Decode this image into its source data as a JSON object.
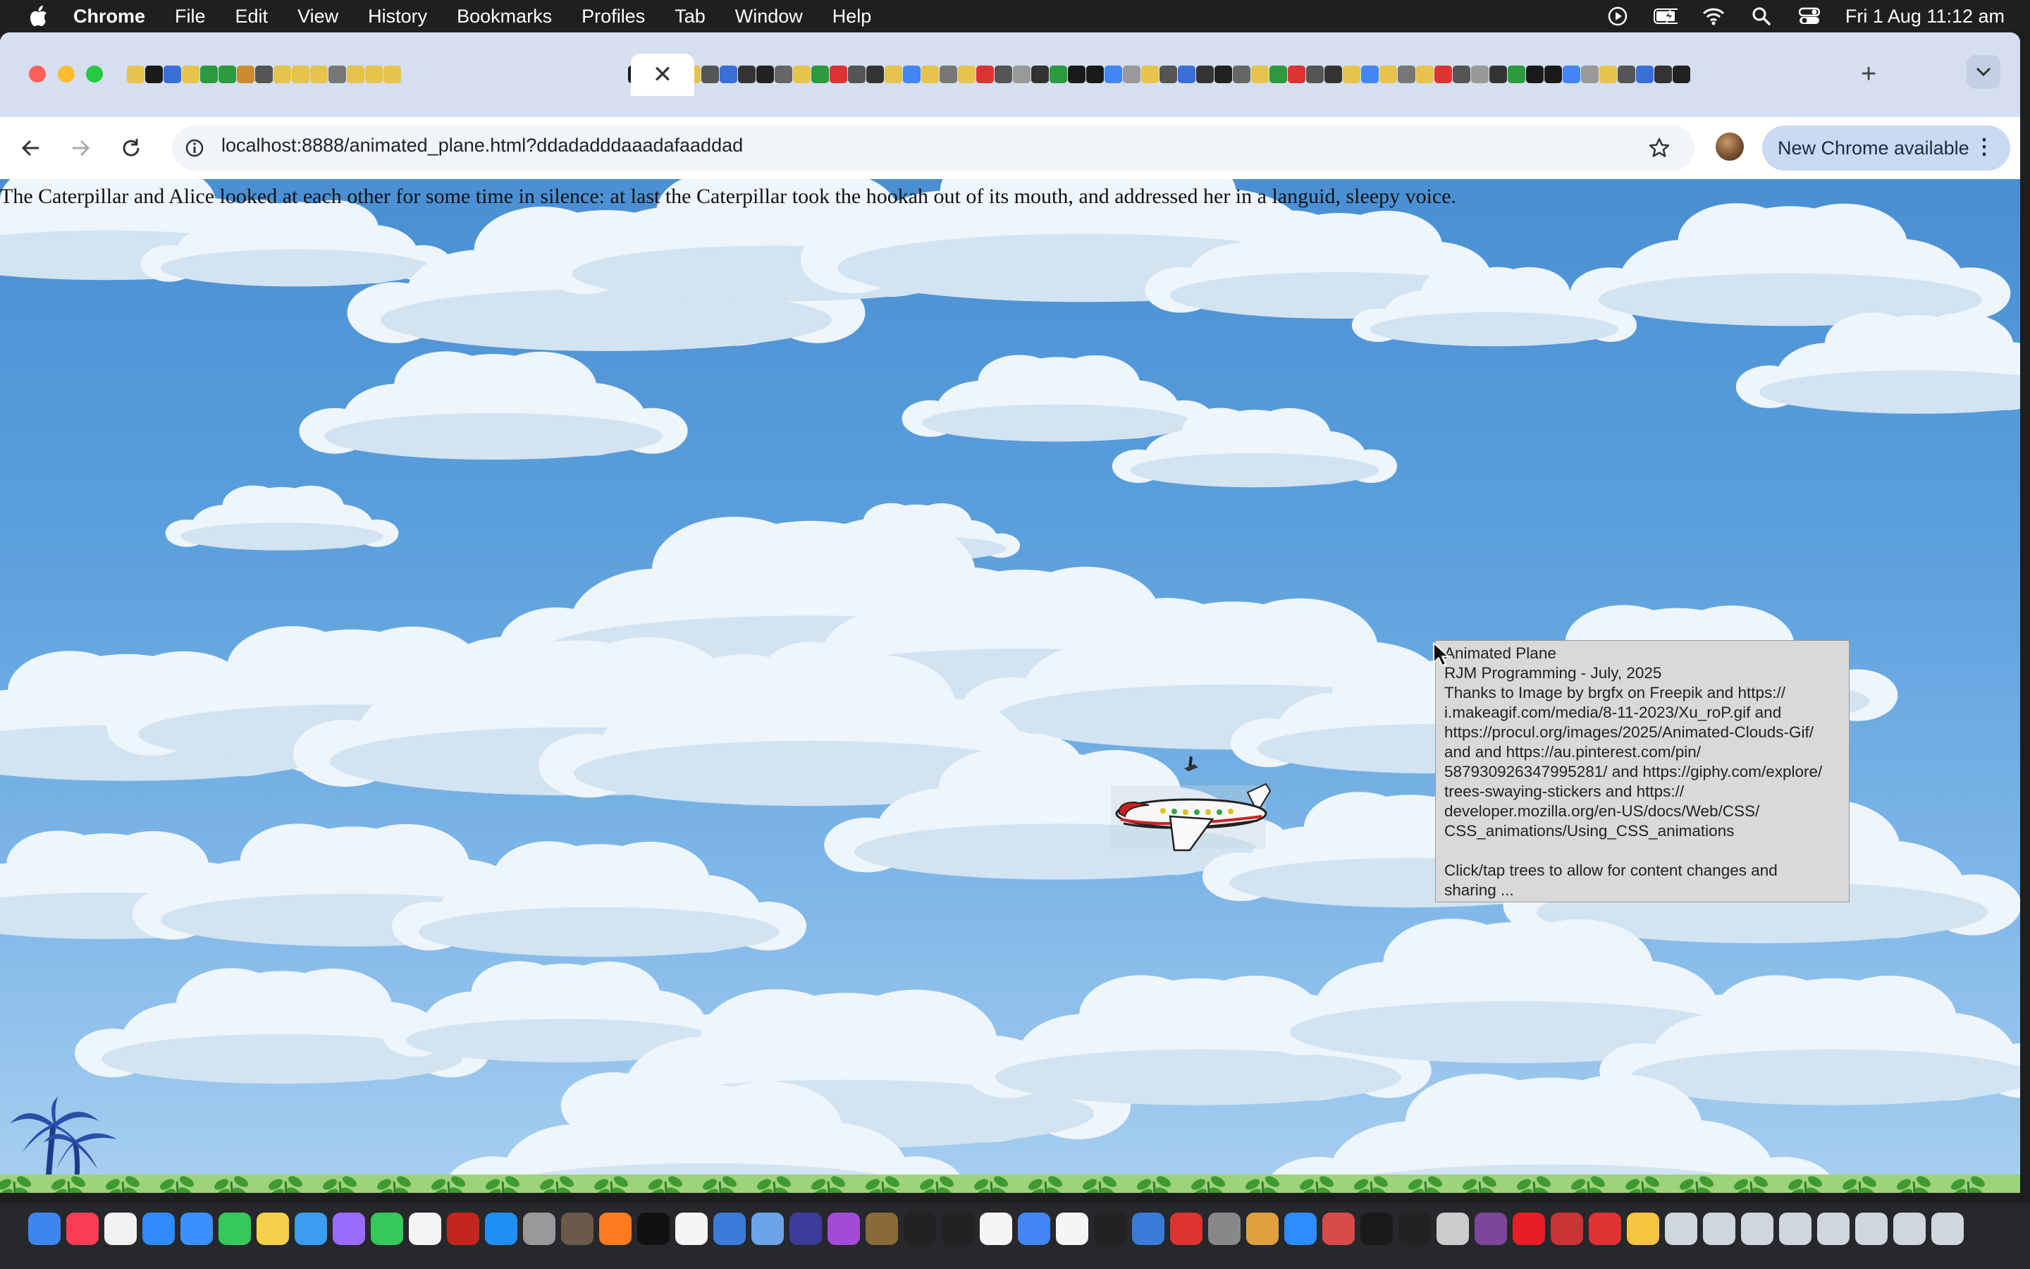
{
  "menubar": {
    "app_name": "Chrome",
    "items": [
      "File",
      "Edit",
      "View",
      "History",
      "Bookmarks",
      "Profiles",
      "Tab",
      "Window",
      "Help"
    ],
    "clock": "Fri 1 Aug  11:12 am",
    "status_icons": [
      "play-circle-icon",
      "battery-charging-icon",
      "wifi-icon",
      "spotlight-search-icon",
      "control-center-icon"
    ]
  },
  "browser": {
    "active_tab_close": "✕",
    "new_tab": "+",
    "url": "localhost:8888/animated_plane.html?ddadadddaaadafaaddad",
    "update_button": "New Chrome available",
    "update_menu": "⋮"
  },
  "page": {
    "paragraph": "The Caterpillar and Alice looked at each other for some time in silence: at last the Caterpillar took the hookah out of its mouth, and addressed her in a languid, sleepy voice.",
    "tooltip_lines": [
      "Animated Plane",
      "RJM Programming - July, 2025",
      "Thanks to Image by brgfx on Freepik and https://",
      "i.makeagif.com/media/8-11-2023/Xu_roP.gif and",
      "https://procul.org/images/2025/Animated-Clouds-Gif/",
      "and  and https://au.pinterest.com/pin/",
      "587930926347995281/ and https://giphy.com/explore/",
      "trees-swaying-stickers and https://",
      "developer.mozilla.org/en-US/docs/Web/CSS/",
      "CSS_animations/Using_CSS_animations",
      "",
      "Click/tap trees to allow for content changes and",
      "sharing ..."
    ]
  },
  "colors": {
    "menubar": "#1f1f1f",
    "tabstrip": "#d5dff0",
    "sky_top": "#4a8fd3",
    "sky_bottom": "#a8cff0",
    "tooltip_bg": "#d9d9d9",
    "update_button": "#c9daf5",
    "dock": "#26282c"
  },
  "dock_apps": [
    "finder-icon",
    "music-icon",
    "reminders-icon",
    "safari-icon",
    "mail-icon",
    "messages-icon",
    "notes-icon",
    "freeform-icon",
    "launchpad-icon",
    "facetime-icon",
    "textedit-icon",
    "filezilla-icon",
    "app-store-icon",
    "calculator-icon",
    "gimp-icon",
    "firefox-icon",
    "apple-tv-icon",
    "news-icon",
    "xcode-icon",
    "preview-icon",
    "bbedit-icon",
    "podcasts-icon",
    "keychain-icon",
    "terminal-icon",
    "terminal-icon",
    "calendar-icon",
    "chrome-icon",
    "file-icon",
    "terminal-icon",
    "finder-search-icon",
    "intellij-icon",
    "system-settings-icon",
    "photo-icon",
    "zoom-icon",
    "affinity-icon",
    "inkscape-icon",
    "mamp-icon",
    "script-editor-icon",
    "tor-icon",
    "opera-icon",
    "compass-icon",
    "photo-booth-icon",
    "tips-icon",
    "folder-icon",
    "folder-icon",
    "folder-icon",
    "folder-icon",
    "folder-icon",
    "folder-icon",
    "folder-icon",
    "trash-icon"
  ]
}
